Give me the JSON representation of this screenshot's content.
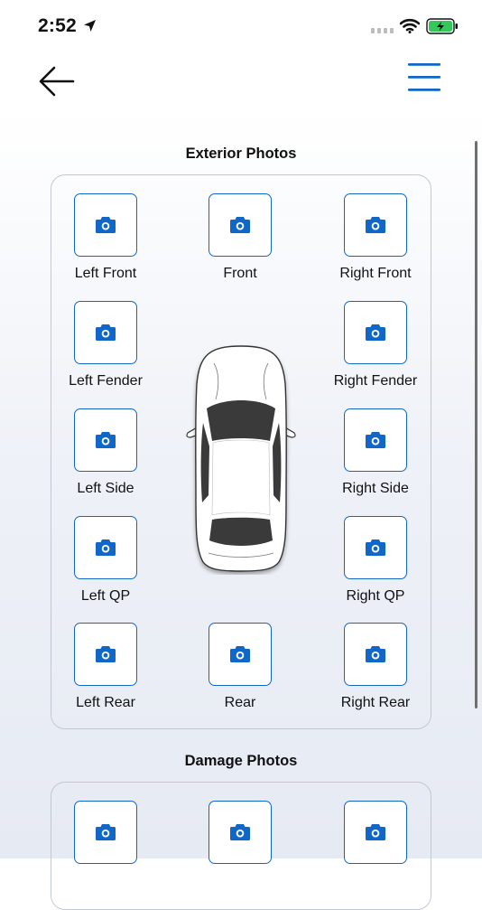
{
  "status": {
    "time": "2:52",
    "icons": [
      "location-arrow-icon",
      "cellular-signal-icon",
      "wifi-icon",
      "battery-charging-icon"
    ],
    "battery_color": "#34c759"
  },
  "nav": {
    "back_icon": "arrow-left-icon",
    "menu_icon": "hamburger-menu-icon"
  },
  "accent_color": "#1167c8",
  "exterior": {
    "title": "Exterior Photos",
    "slots": [
      {
        "label": "Left Front"
      },
      {
        "label": "Front"
      },
      {
        "label": "Right Front"
      },
      {
        "label": "Left Fender"
      },
      {
        "label": "Right Fender"
      },
      {
        "label": "Left Side"
      },
      {
        "label": "Right Side"
      },
      {
        "label": "Left QP"
      },
      {
        "label": "Right QP"
      },
      {
        "label": "Left Rear"
      },
      {
        "label": "Rear"
      },
      {
        "label": "Right Rear"
      }
    ],
    "center_image": "car-top-view"
  },
  "damage": {
    "title": "Damage Photos",
    "slots": [
      {
        "label": ""
      },
      {
        "label": ""
      },
      {
        "label": ""
      }
    ]
  }
}
